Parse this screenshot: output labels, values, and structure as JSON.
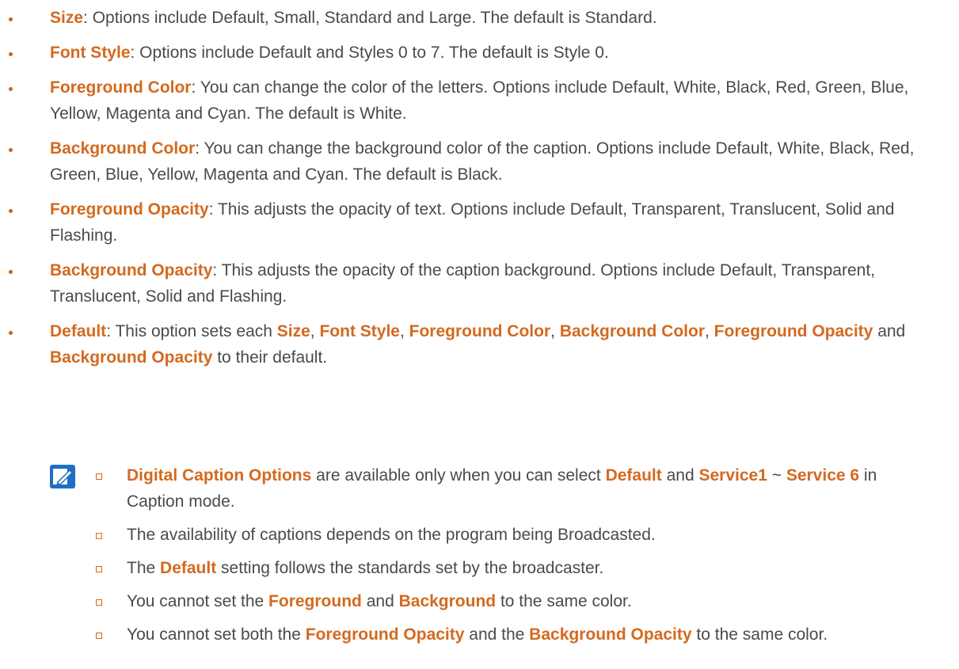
{
  "bullets": [
    {
      "segments": [
        {
          "t": "Size",
          "h": true
        },
        {
          "t": ": Options include Default, Small, Standard and Large. The default is Standard.",
          "h": false
        }
      ]
    },
    {
      "segments": [
        {
          "t": "Font Style",
          "h": true
        },
        {
          "t": ": Options include Default and Styles 0 to 7. The default is Style 0.",
          "h": false
        }
      ]
    },
    {
      "segments": [
        {
          "t": "Foreground Color",
          "h": true
        },
        {
          "t": ": You can change the color of the letters. Options include Default, White, Black, Red, Green, Blue, Yellow, Magenta and Cyan. The default is White.",
          "h": false
        }
      ]
    },
    {
      "segments": [
        {
          "t": "Background Color",
          "h": true
        },
        {
          "t": ": You can change the background color of the caption. Options include Default, White, Black, Red, Green, Blue, Yellow, Magenta and Cyan. The default is Black.",
          "h": false
        }
      ]
    },
    {
      "segments": [
        {
          "t": "Foreground Opacity",
          "h": true
        },
        {
          "t": ": This adjusts the opacity of text. Options include Default, Transparent, Translucent, Solid and Flashing.",
          "h": false
        }
      ]
    },
    {
      "segments": [
        {
          "t": "Background Opacity",
          "h": true
        },
        {
          "t": ": This adjusts the opacity of the caption background. Options include Default, Transparent, Translucent, Solid and Flashing.",
          "h": false
        }
      ]
    },
    {
      "segments": [
        {
          "t": "Default",
          "h": true
        },
        {
          "t": ": This option sets each ",
          "h": false
        },
        {
          "t": "Size",
          "h": true
        },
        {
          "t": ", ",
          "h": false
        },
        {
          "t": "Font Style",
          "h": true
        },
        {
          "t": ", ",
          "h": false
        },
        {
          "t": "Foreground Color",
          "h": true
        },
        {
          "t": ", ",
          "h": false
        },
        {
          "t": "Background Color",
          "h": true
        },
        {
          "t": ", ",
          "h": false
        },
        {
          "t": "Foreground Opacity",
          "h": true
        },
        {
          "t": " and ",
          "h": false
        },
        {
          "t": "Background Opacity",
          "h": true
        },
        {
          "t": " to their default.",
          "h": false
        }
      ]
    }
  ],
  "note_icon": "note-pencil-icon",
  "notes": [
    {
      "segments": [
        {
          "t": "Digital Caption Options",
          "h": true
        },
        {
          "t": " are available only when you can select ",
          "h": false
        },
        {
          "t": "Default",
          "h": true
        },
        {
          "t": " and ",
          "h": false
        },
        {
          "t": "Service1",
          "h": true
        },
        {
          "t": " ~ ",
          "h": false
        },
        {
          "t": "Service 6",
          "h": true
        },
        {
          "t": " in Caption mode.",
          "h": false
        }
      ]
    },
    {
      "segments": [
        {
          "t": "The availability of captions depends on the program being Broadcasted.",
          "h": false
        }
      ]
    },
    {
      "segments": [
        {
          "t": "The ",
          "h": false
        },
        {
          "t": "Default",
          "h": true
        },
        {
          "t": " setting follows the standards set by the broadcaster.",
          "h": false
        }
      ]
    },
    {
      "segments": [
        {
          "t": "You cannot set the ",
          "h": false
        },
        {
          "t": "Foreground",
          "h": true
        },
        {
          "t": " and ",
          "h": false
        },
        {
          "t": "Background",
          "h": true
        },
        {
          "t": " to the same color.",
          "h": false
        }
      ]
    },
    {
      "segments": [
        {
          "t": "You cannot set both the ",
          "h": false
        },
        {
          "t": "Foreground Opacity",
          "h": true
        },
        {
          "t": " and the ",
          "h": false
        },
        {
          "t": "Background Opacity",
          "h": true
        },
        {
          "t": " to the same color.",
          "h": false
        }
      ]
    }
  ],
  "colors": {
    "highlight": "#d4691f",
    "body_text": "#4a4a4a",
    "icon_blue": "#1f6fc4"
  }
}
